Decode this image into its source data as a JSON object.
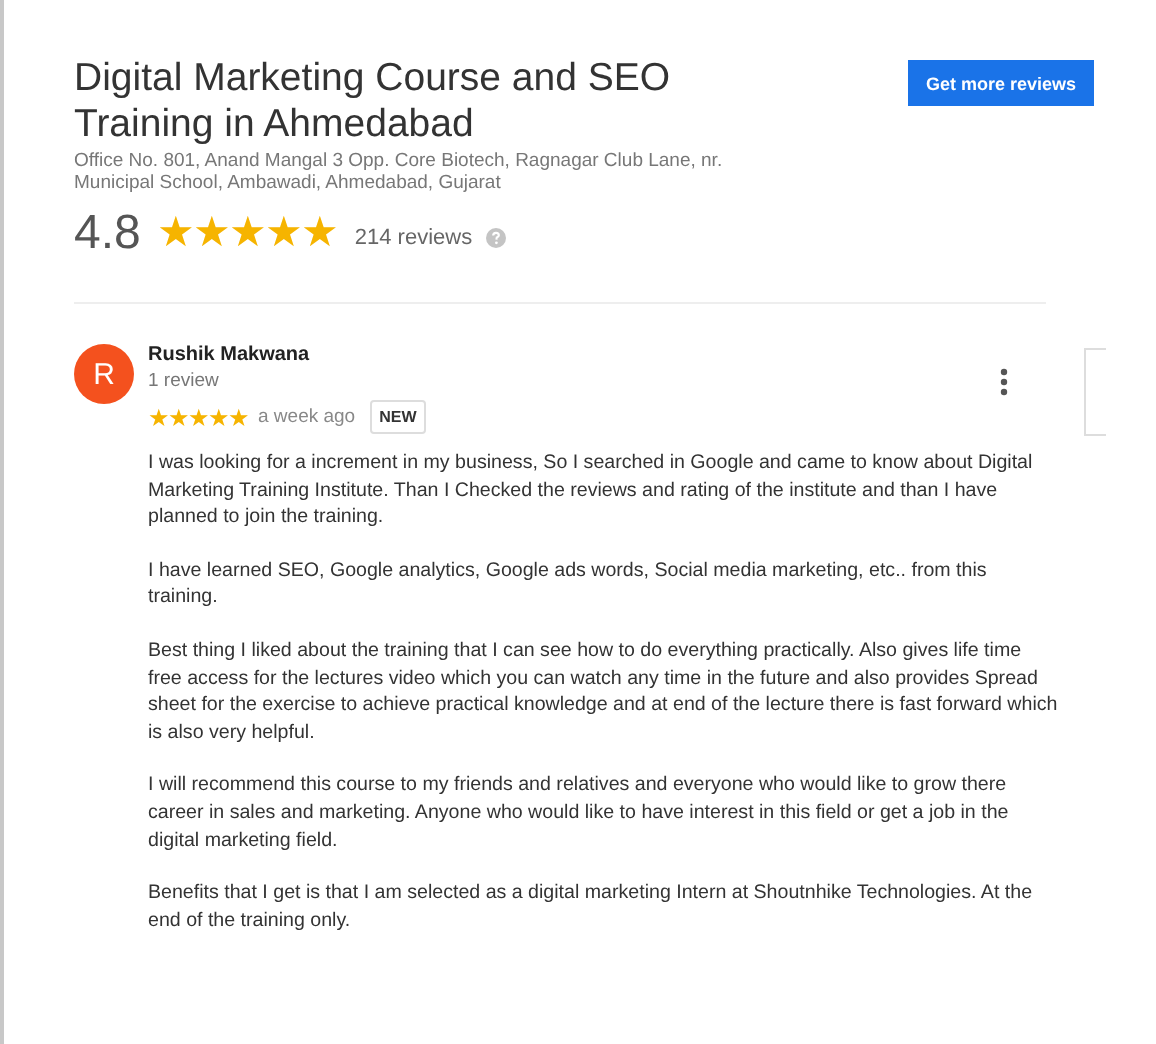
{
  "business": {
    "title": "Digital Marketing Course and SEO Training in Ahmedabad",
    "address": "Office No. 801, Anand Mangal 3 Opp. Core Biotech, Ragnagar Club Lane, nr. Municipal School, Ambawadi, Ahmedabad, Gujarat",
    "rating": "4.8",
    "stars": 5,
    "review_count": "214 reviews"
  },
  "button": "Get more reviews",
  "review": {
    "avatar_letter": "R",
    "author": "Rushik Makwana",
    "author_reviews": "1 review",
    "stars": 5,
    "time": "a week ago",
    "badge": "NEW",
    "paragraphs": [
      "I was looking for a increment in my business, So I searched in Google and came to know about Digital Marketing Training Institute. Than I Checked the reviews and rating of the institute and than I have planned to join the training.",
      "I have learned SEO, Google analytics, Google ads words, Social media marketing, etc.. from this training.",
      "Best thing I liked about the training that I can see how to do everything practically. Also gives life time free access for the lectures video which you can watch any time in the future and also provides Spread sheet for the exercise to achieve practical knowledge and at end of the lecture there is fast forward which is also very helpful.",
      "I will  recommend this course to my friends and relatives and everyone who would like to grow there career in sales and marketing. Anyone who would like to have interest in this field or get a job in the digital marketing field.",
      "Benefits that I get is that I am selected as a digital marketing Intern at Shoutnhike Technologies. At the end of the training only."
    ]
  }
}
